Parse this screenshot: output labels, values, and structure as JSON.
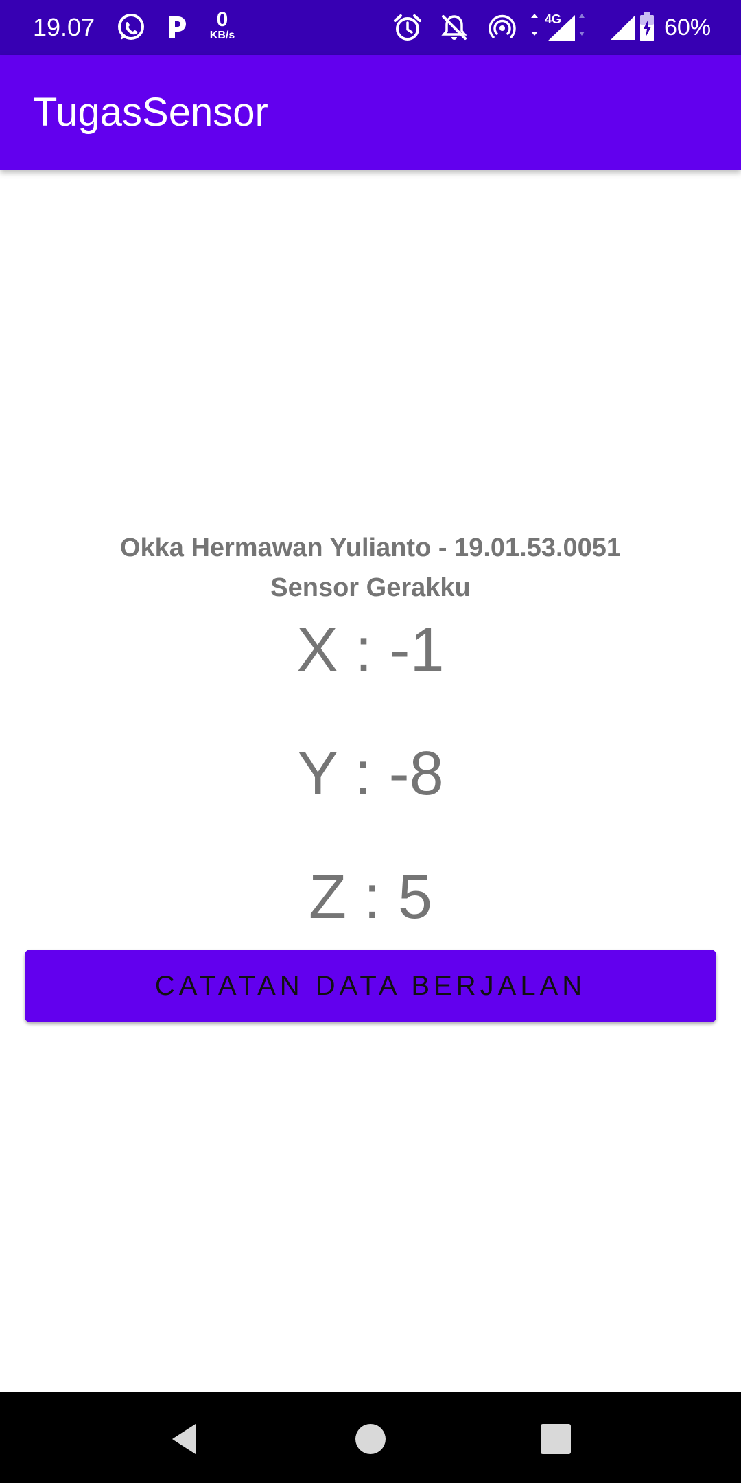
{
  "status_bar": {
    "time": "19.07",
    "net_speed_value": "0",
    "net_speed_unit": "KB/s",
    "network_type": "4G",
    "battery": "60%",
    "icons": [
      "whatsapp-icon",
      "parking-icon",
      "alarm-icon",
      "notifications-off-icon",
      "hotspot-icon",
      "signal-icon",
      "battery-charging-icon"
    ]
  },
  "app_bar": {
    "title": "TugasSensor"
  },
  "content": {
    "author": "Okka Hermawan Yulianto - 19.01.53.0051",
    "sensor_title": "Sensor Gerakku",
    "x_text": "X : -1",
    "y_text": "Y : -8",
    "z_text": "Z : 5",
    "button_label": "CATATAN DATA BERJALAN"
  },
  "nav_bar": {
    "buttons": [
      "back",
      "home",
      "recents"
    ]
  },
  "colors": {
    "status_bar": "#3700b3",
    "primary": "#6200ee",
    "text_gray": "#757575",
    "nav_bar": "#000000"
  }
}
